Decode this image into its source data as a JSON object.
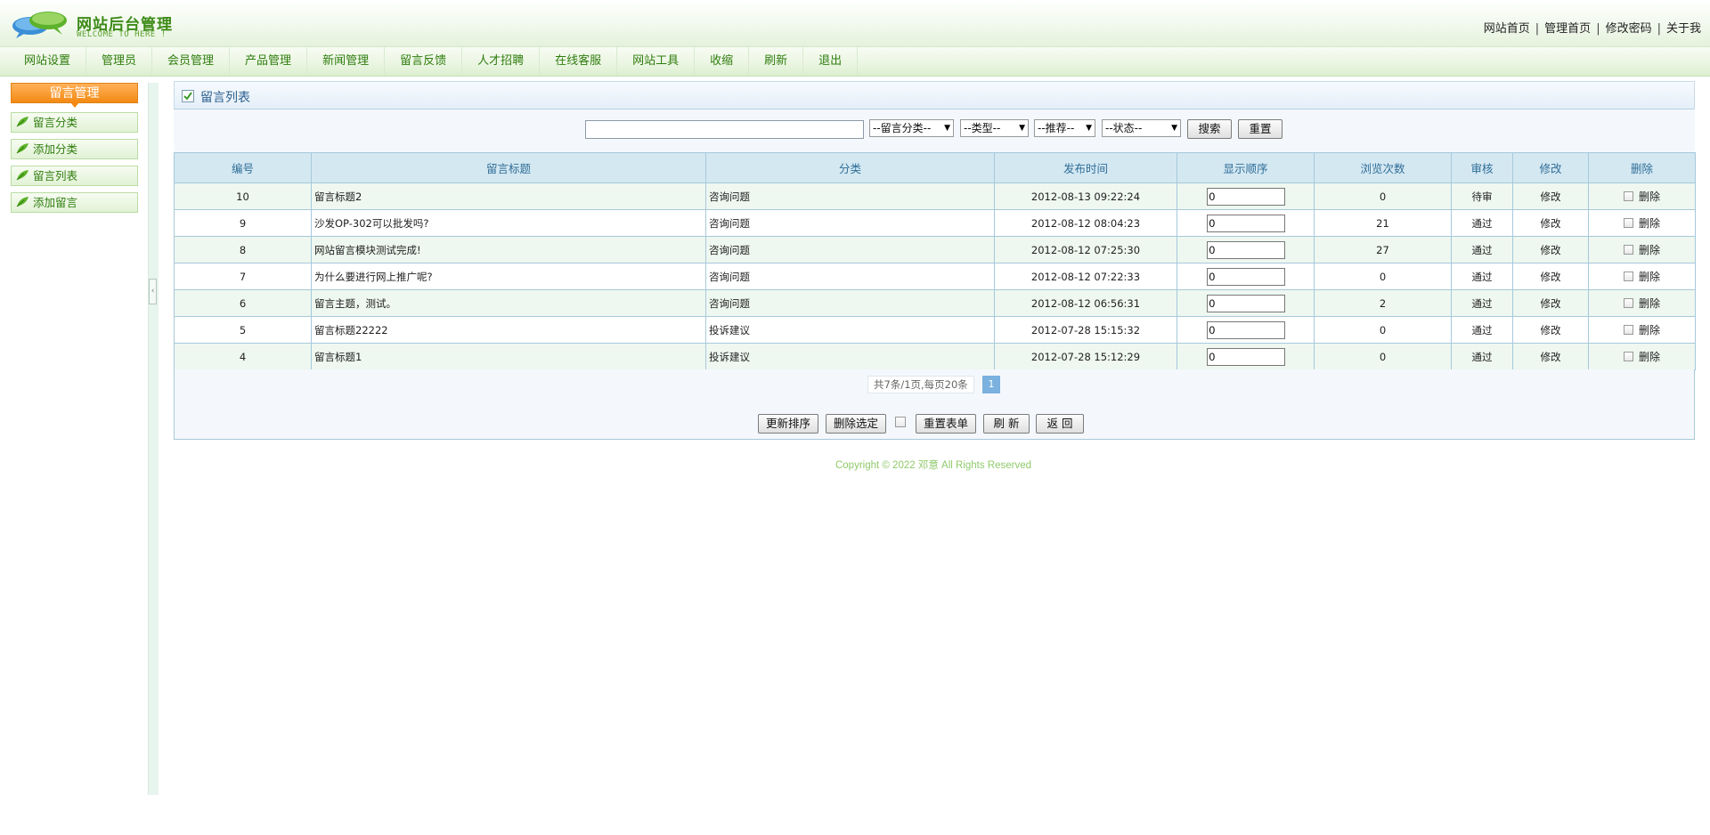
{
  "header": {
    "title": "网站后台管理",
    "subtitle": "WELCOME TO HERE !",
    "links": [
      "网站首页",
      "管理首页",
      "修改密码",
      "关于我"
    ],
    "separator": "|"
  },
  "nav": {
    "items": [
      "网站设置",
      "管理员",
      "会员管理",
      "产品管理",
      "新闻管理",
      "留言反馈",
      "人才招聘",
      "在线客服",
      "网站工具",
      "收缩",
      "刷新",
      "退出"
    ]
  },
  "sidebar": {
    "heading": "留言管理",
    "items": [
      "留言分类",
      "添加分类",
      "留言列表",
      "添加留言"
    ]
  },
  "splitter": {
    "toggle": "‹"
  },
  "panel": {
    "title": "留言列表",
    "search": {
      "input_value": "",
      "category_select": "--留言分类--",
      "type_select": "--类型--",
      "recommend_select": "--推荐--",
      "status_select": "--状态--",
      "search_button": "搜索",
      "reset_button": "重置"
    },
    "table": {
      "columns": [
        "编号",
        "留言标题",
        "分类",
        "发布时间",
        "显示顺序",
        "浏览次数",
        "审核",
        "修改",
        "删除"
      ],
      "rows": [
        {
          "id": "10",
          "title": "留言标题2",
          "category": "咨询问题",
          "time": "2012-08-13 09:22:24",
          "order": "0",
          "views": "0",
          "audit": "待审",
          "edit": "修改",
          "delete": "删除"
        },
        {
          "id": "9",
          "title": "沙发OP-302可以批发吗?",
          "category": "咨询问题",
          "time": "2012-08-12 08:04:23",
          "order": "0",
          "views": "21",
          "audit": "通过",
          "edit": "修改",
          "delete": "删除"
        },
        {
          "id": "8",
          "title": "网站留言模块测试完成!",
          "category": "咨询问题",
          "time": "2012-08-12 07:25:30",
          "order": "0",
          "views": "27",
          "audit": "通过",
          "edit": "修改",
          "delete": "删除"
        },
        {
          "id": "7",
          "title": "为什么要进行网上推广呢?",
          "category": "咨询问题",
          "time": "2012-08-12 07:22:33",
          "order": "0",
          "views": "0",
          "audit": "通过",
          "edit": "修改",
          "delete": "删除"
        },
        {
          "id": "6",
          "title": "留言主题，测试。",
          "category": "咨询问题",
          "time": "2012-08-12 06:56:31",
          "order": "0",
          "views": "2",
          "audit": "通过",
          "edit": "修改",
          "delete": "删除"
        },
        {
          "id": "5",
          "title": "留言标题22222",
          "category": "投诉建议",
          "time": "2012-07-28 15:15:32",
          "order": "0",
          "views": "0",
          "audit": "通过",
          "edit": "修改",
          "delete": "删除"
        },
        {
          "id": "4",
          "title": "留言标题1",
          "category": "投诉建议",
          "time": "2012-07-28 15:12:29",
          "order": "0",
          "views": "0",
          "audit": "通过",
          "edit": "修改",
          "delete": "删除"
        }
      ]
    },
    "pager": {
      "info": "共7条/1页,每页20条",
      "current": "1"
    },
    "actions": {
      "update_order": "更新排序",
      "delete_selected": "删除选定",
      "reset_form": "重置表单",
      "refresh": "刷 新",
      "back": "返 回"
    }
  },
  "footer": {
    "copyright": "Copyright © 2022  邓意  All Rights Reserved"
  },
  "colors": {
    "brand_green": "#3d8a17",
    "accent_orange": "#f28a12",
    "header_blue": "#d4e8f2",
    "pending_red": "#e00000"
  }
}
